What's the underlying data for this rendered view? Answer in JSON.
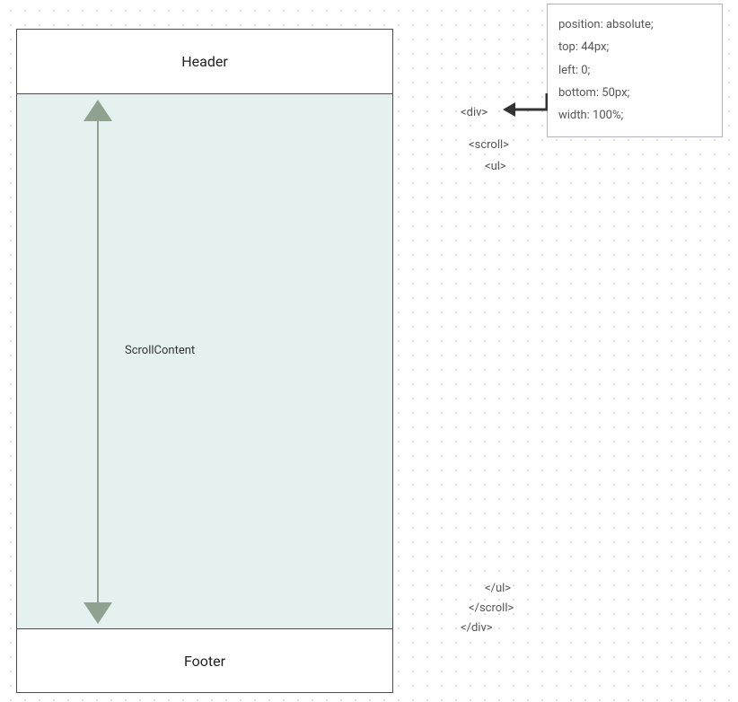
{
  "layout": {
    "header_label": "Header",
    "scroll_label": "ScrollContent",
    "footer_label": "Footer"
  },
  "css_rules": {
    "line1": "position: absolute;",
    "line2": "top: 44px;",
    "line3": "left: 0;",
    "line4": "bottom: 50px;",
    "line5": "width: 100%;"
  },
  "code": {
    "div_open": "<div>",
    "scroll_open": "<scroll>",
    "ul_open": "<ul>",
    "ul_close": "</ul>",
    "scroll_close": "</scroll>",
    "div_close": "</div>"
  }
}
